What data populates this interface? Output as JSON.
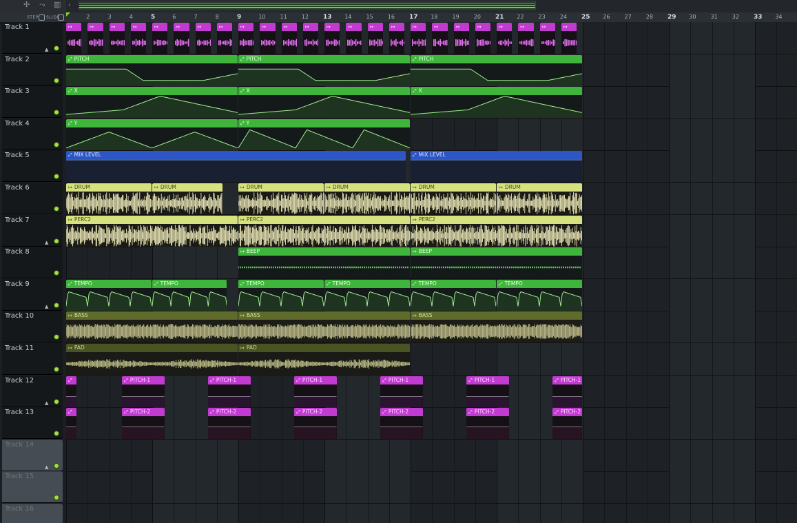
{
  "toolbar": {
    "step_label": "STEP",
    "slide_label": "SLIDE",
    "icons": [
      "pattern-icon",
      "automation-icon",
      "snap-icon"
    ]
  },
  "ruler": {
    "numbers": [
      2,
      3,
      4,
      5,
      6,
      7,
      8,
      9,
      10,
      11,
      12,
      13,
      14,
      15,
      16,
      17,
      18,
      19,
      20,
      21,
      22,
      23,
      24,
      25,
      26,
      27,
      28,
      29,
      30,
      31,
      32,
      33,
      34
    ],
    "major": [
      5,
      9,
      13,
      17,
      21,
      25,
      29,
      33
    ]
  },
  "colors": {
    "pink": "#c23bd1",
    "green": "#3fb53b",
    "blue": "#2c55c6",
    "cream": "#d6e17f",
    "olive": "#5f6b2b",
    "darkolive": "#4a5322",
    "lime_led": "#a4e23a"
  },
  "tracks": [
    {
      "name": "Track 1",
      "arrow": true,
      "led": true
    },
    {
      "name": "Track 2",
      "arrow": false,
      "led": true
    },
    {
      "name": "Track 3",
      "arrow": false,
      "led": true
    },
    {
      "name": "Track 4",
      "arrow": false,
      "led": true
    },
    {
      "name": "Track 5",
      "arrow": false,
      "led": true
    },
    {
      "name": "Track 6",
      "arrow": false,
      "led": true
    },
    {
      "name": "Track 7",
      "arrow": true,
      "led": true
    },
    {
      "name": "Track 8",
      "arrow": false,
      "led": true
    },
    {
      "name": "Track 9",
      "arrow": true,
      "led": true
    },
    {
      "name": "Track 10",
      "arrow": false,
      "led": true
    },
    {
      "name": "Track 11",
      "arrow": false,
      "led": true
    },
    {
      "name": "Track 12",
      "arrow": true,
      "led": true
    },
    {
      "name": "Track 13",
      "arrow": false,
      "led": true
    },
    {
      "name": "Track 14",
      "arrow": true,
      "led": true,
      "empty": true
    },
    {
      "name": "Track 15",
      "arrow": false,
      "led": true,
      "empty": true
    },
    {
      "name": "Track 16",
      "arrow": false,
      "led": false,
      "empty": true
    }
  ],
  "clips": [
    {
      "track": 0,
      "start": 1,
      "len": 0.75,
      "label": "",
      "type": "pattern",
      "color": "pink",
      "repeat": 24
    },
    {
      "track": 1,
      "start": 1,
      "len": 8,
      "label": "PITCH",
      "type": "automation",
      "color": "green",
      "shape": "pitch"
    },
    {
      "track": 1,
      "start": 9,
      "len": 8,
      "label": "PITCH",
      "type": "automation",
      "color": "green",
      "shape": "pitch"
    },
    {
      "track": 1,
      "start": 17,
      "len": 8,
      "label": "PITCH",
      "type": "automation",
      "color": "green",
      "shape": "pitch"
    },
    {
      "track": 2,
      "start": 1,
      "len": 8,
      "label": "X",
      "type": "automation",
      "color": "green",
      "shape": "x"
    },
    {
      "track": 2,
      "start": 9,
      "len": 8,
      "label": "X",
      "type": "automation",
      "color": "green",
      "shape": "x"
    },
    {
      "track": 2,
      "start": 17,
      "len": 8,
      "label": "X",
      "type": "automation",
      "color": "green",
      "shape": "x"
    },
    {
      "track": 3,
      "start": 1,
      "len": 8,
      "label": "Y",
      "type": "automation",
      "color": "green",
      "shape": "y1"
    },
    {
      "track": 3,
      "start": 9,
      "len": 8,
      "label": "Y",
      "type": "automation",
      "color": "green",
      "shape": "y2"
    },
    {
      "track": 4,
      "start": 1,
      "len": 15.8,
      "label": "MIX LEVEL",
      "type": "automation",
      "color": "blue",
      "shape": "mix"
    },
    {
      "track": 4,
      "start": 17,
      "len": 8,
      "label": "MIX LEVEL",
      "type": "automation",
      "color": "blue",
      "shape": "mix"
    },
    {
      "track": 5,
      "start": 1,
      "len": 4,
      "label": "DRUM",
      "type": "audio",
      "color": "cream",
      "shape": "drum"
    },
    {
      "track": 5,
      "start": 5,
      "len": 3.3,
      "label": "DRUM",
      "type": "audio",
      "color": "cream",
      "shape": "drum"
    },
    {
      "track": 5,
      "start": 9,
      "len": 4,
      "label": "DRUM",
      "type": "audio",
      "color": "cream",
      "shape": "drum"
    },
    {
      "track": 5,
      "start": 13,
      "len": 4,
      "label": "DRUM",
      "type": "audio",
      "color": "cream",
      "shape": "drum"
    },
    {
      "track": 5,
      "start": 17,
      "len": 4,
      "label": "DRUM",
      "type": "audio",
      "color": "cream",
      "shape": "drum"
    },
    {
      "track": 5,
      "start": 21,
      "len": 4,
      "label": "DRUM",
      "type": "audio",
      "color": "cream",
      "shape": "drum"
    },
    {
      "track": 6,
      "start": 1,
      "len": 8,
      "label": "PERC2",
      "type": "audio",
      "color": "cream",
      "shape": "perc"
    },
    {
      "track": 6,
      "start": 9,
      "len": 8,
      "label": "PERC2",
      "type": "audio",
      "color": "cream",
      "shape": "perc"
    },
    {
      "track": 6,
      "start": 17,
      "len": 8,
      "label": "PERC2",
      "type": "audio",
      "color": "cream",
      "shape": "perc"
    },
    {
      "track": 7,
      "start": 9,
      "len": 8,
      "label": "BEEP",
      "type": "audio",
      "color": "green",
      "shape": "beep"
    },
    {
      "track": 7,
      "start": 17,
      "len": 8,
      "label": "BEEP",
      "type": "audio",
      "color": "green",
      "shape": "beep"
    },
    {
      "track": 8,
      "start": 1,
      "len": 4,
      "label": "TEMPO",
      "type": "automation",
      "color": "green",
      "shape": "tempo"
    },
    {
      "track": 8,
      "start": 5,
      "len": 3.5,
      "label": "TEMPO",
      "type": "automation",
      "color": "green",
      "shape": "tempo"
    },
    {
      "track": 8,
      "start": 9,
      "len": 4,
      "label": "TEMPO",
      "type": "automation",
      "color": "green",
      "shape": "tempo"
    },
    {
      "track": 8,
      "start": 13,
      "len": 4,
      "label": "TEMPO",
      "type": "automation",
      "color": "green",
      "shape": "tempo"
    },
    {
      "track": 8,
      "start": 17,
      "len": 4,
      "label": "TEMPO",
      "type": "automation",
      "color": "green",
      "shape": "tempo"
    },
    {
      "track": 8,
      "start": 21,
      "len": 4,
      "label": "TEMPO",
      "type": "automation",
      "color": "green",
      "shape": "tempo"
    },
    {
      "track": 9,
      "start": 1,
      "len": 8,
      "label": "BASS",
      "type": "audio",
      "color": "olive",
      "shape": "bass"
    },
    {
      "track": 9,
      "start": 9,
      "len": 8,
      "label": "BASS",
      "type": "audio",
      "color": "olive",
      "shape": "bass"
    },
    {
      "track": 9,
      "start": 17,
      "len": 8,
      "label": "BASS",
      "type": "audio",
      "color": "olive",
      "shape": "bass"
    },
    {
      "track": 10,
      "start": 1,
      "len": 8,
      "label": "PAD",
      "type": "audio",
      "color": "darkolive",
      "shape": "pad"
    },
    {
      "track": 10,
      "start": 9,
      "len": 8,
      "label": "PAD",
      "type": "audio",
      "color": "darkolive",
      "shape": "pad"
    },
    {
      "track": 11,
      "start": 1,
      "len": 0.5,
      "label": "",
      "type": "automation",
      "color": "pink",
      "shape": "flat"
    },
    {
      "track": 11,
      "start": 3.6,
      "len": 2,
      "label": "PITCH-1",
      "type": "automation",
      "color": "pink",
      "shape": "flat"
    },
    {
      "track": 11,
      "start": 7.6,
      "len": 2,
      "label": "PITCH-1",
      "type": "automation",
      "color": "pink",
      "shape": "flat"
    },
    {
      "track": 11,
      "start": 11.6,
      "len": 2,
      "label": "PITCH-1",
      "type": "automation",
      "color": "pink",
      "shape": "flat"
    },
    {
      "track": 11,
      "start": 15.6,
      "len": 2,
      "label": "PITCH-1",
      "type": "automation",
      "color": "pink",
      "shape": "flat"
    },
    {
      "track": 11,
      "start": 19.6,
      "len": 2,
      "label": "PITCH-1",
      "type": "automation",
      "color": "pink",
      "shape": "flat"
    },
    {
      "track": 11,
      "start": 23.6,
      "len": 1.4,
      "label": "PITCH-1",
      "type": "automation",
      "color": "pink",
      "shape": "flat"
    },
    {
      "track": 12,
      "start": 1,
      "len": 0.5,
      "label": "",
      "type": "automation",
      "color": "pink",
      "shape": "flat2"
    },
    {
      "track": 12,
      "start": 3.6,
      "len": 2,
      "label": "PITCH-2",
      "type": "automation",
      "color": "pink",
      "shape": "flat2"
    },
    {
      "track": 12,
      "start": 7.6,
      "len": 2,
      "label": "PITCH-2",
      "type": "automation",
      "color": "pink",
      "shape": "flat2"
    },
    {
      "track": 12,
      "start": 11.6,
      "len": 2,
      "label": "PITCH-2",
      "type": "automation",
      "color": "pink",
      "shape": "flat2"
    },
    {
      "track": 12,
      "start": 15.6,
      "len": 2,
      "label": "PITCH-2",
      "type": "automation",
      "color": "pink",
      "shape": "flat2"
    },
    {
      "track": 12,
      "start": 19.6,
      "len": 2,
      "label": "PITCH-2",
      "type": "automation",
      "color": "pink",
      "shape": "flat2"
    },
    {
      "track": 12,
      "start": 23.6,
      "len": 1.4,
      "label": "PITCH-2",
      "type": "automation",
      "color": "pink",
      "shape": "flat2"
    }
  ]
}
